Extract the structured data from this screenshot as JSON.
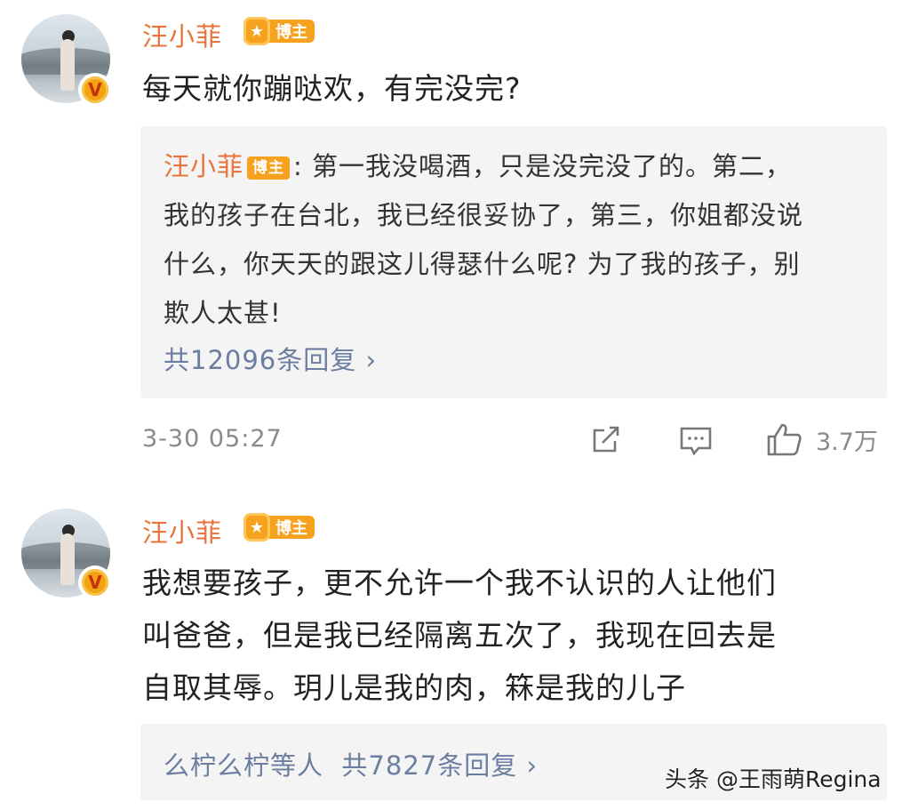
{
  "comment1": {
    "username": "汪小菲",
    "badge": "博主",
    "verified_mark": "V",
    "text": "每天就你蹦哒欢，有完没完?",
    "reply": {
      "author": "汪小菲",
      "badge": "博主",
      "separator": ": ",
      "text_lines": [
        "第一我没喝酒，只是没完没了的。第二，",
        "我的孩子在台北，我已经很妥协了，第三，你姐都没说",
        "什么，你天天的跟这儿得瑟什么呢? 为了我的孩子，别",
        "欺人太甚!"
      ],
      "count_label": "共12096条回复 ›"
    },
    "time": "3-30 05:27",
    "likes": "3.7万",
    "icons": [
      "share-icon",
      "comment-icon",
      "like-icon"
    ]
  },
  "comment2": {
    "username": "汪小菲",
    "badge": "博主",
    "verified_mark": "V",
    "text_lines": [
      "我想要孩子，更不允许一个我不认识的人让他们",
      "叫爸爸，但是我已经隔离五次了，我现在回去是",
      "自取其辱。玥儿是我的肉，箖是我的儿子"
    ],
    "reply": {
      "count_label": "么柠么柠等人  共7827条回复 ›"
    }
  },
  "watermark": "头条 @王雨萌Regina",
  "colors": {
    "username": "#e8743b",
    "badge": "#f6a21e",
    "reply_link": "#6b7ea0",
    "reply_bg": "#f4f4f4",
    "meta": "#8a8a8a"
  }
}
